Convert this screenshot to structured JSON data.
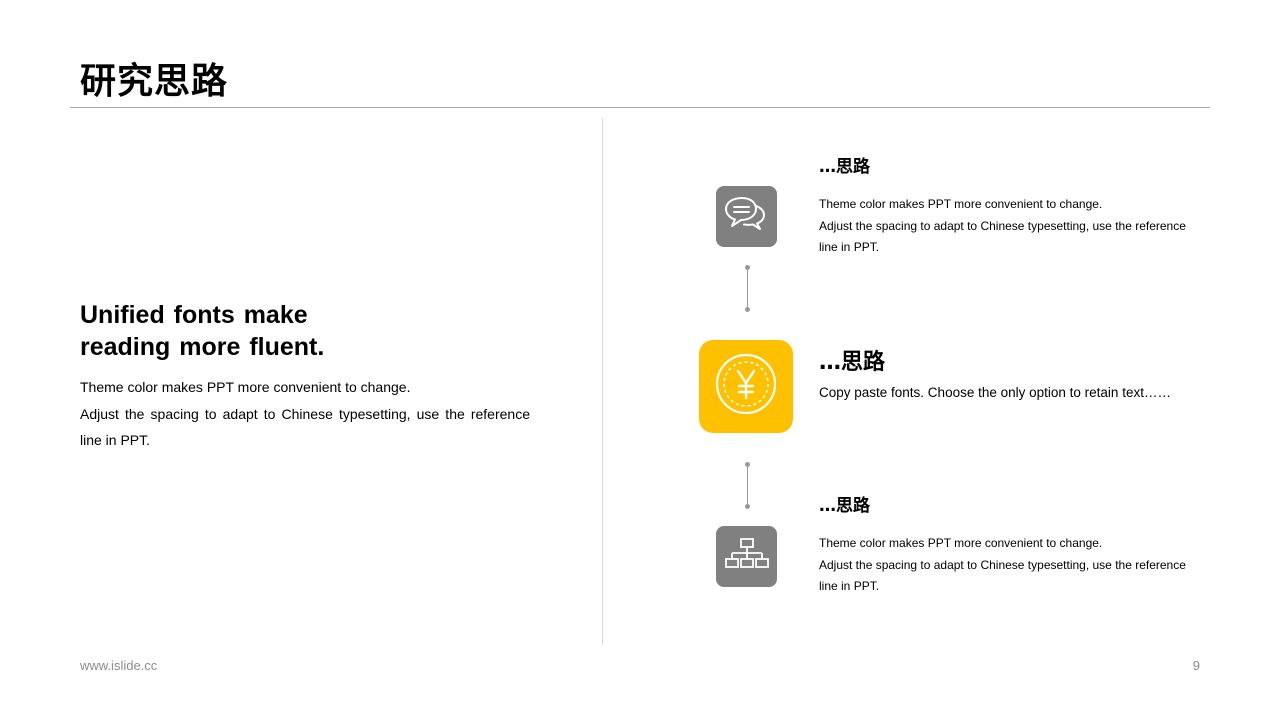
{
  "slide": {
    "title": "研究思路",
    "page_number": "9"
  },
  "left": {
    "heading_line1": "Unified fonts make",
    "heading_line2": "reading more fluent.",
    "body_line1": "Theme color makes PPT more convenient to change.",
    "body_line2": "Adjust the spacing to adapt to Chinese typesetting, use the reference line in PPT."
  },
  "items": [
    {
      "icon": "chat-bubbles-icon",
      "title": "…思路",
      "line1": "Theme color makes PPT more convenient to change.",
      "line2": "Adjust the spacing to adapt to Chinese typesetting, use the reference line in PPT."
    },
    {
      "icon": "yen-coin-icon",
      "title": "…思路",
      "line1": "Copy paste fonts. Choose the only option to retain text……"
    },
    {
      "icon": "org-chart-icon",
      "title": "…思路",
      "line1": "Theme color makes PPT more convenient to change.",
      "line2": "Adjust the spacing to adapt to Chinese typesetting, use the reference line in PPT."
    }
  ],
  "footer": {
    "url": "www.islide.cc"
  },
  "colors": {
    "accent": "#ffc000",
    "icon_gray": "#808080",
    "rule": "#a6a6a6",
    "muted_text": "#8c8c8c"
  }
}
